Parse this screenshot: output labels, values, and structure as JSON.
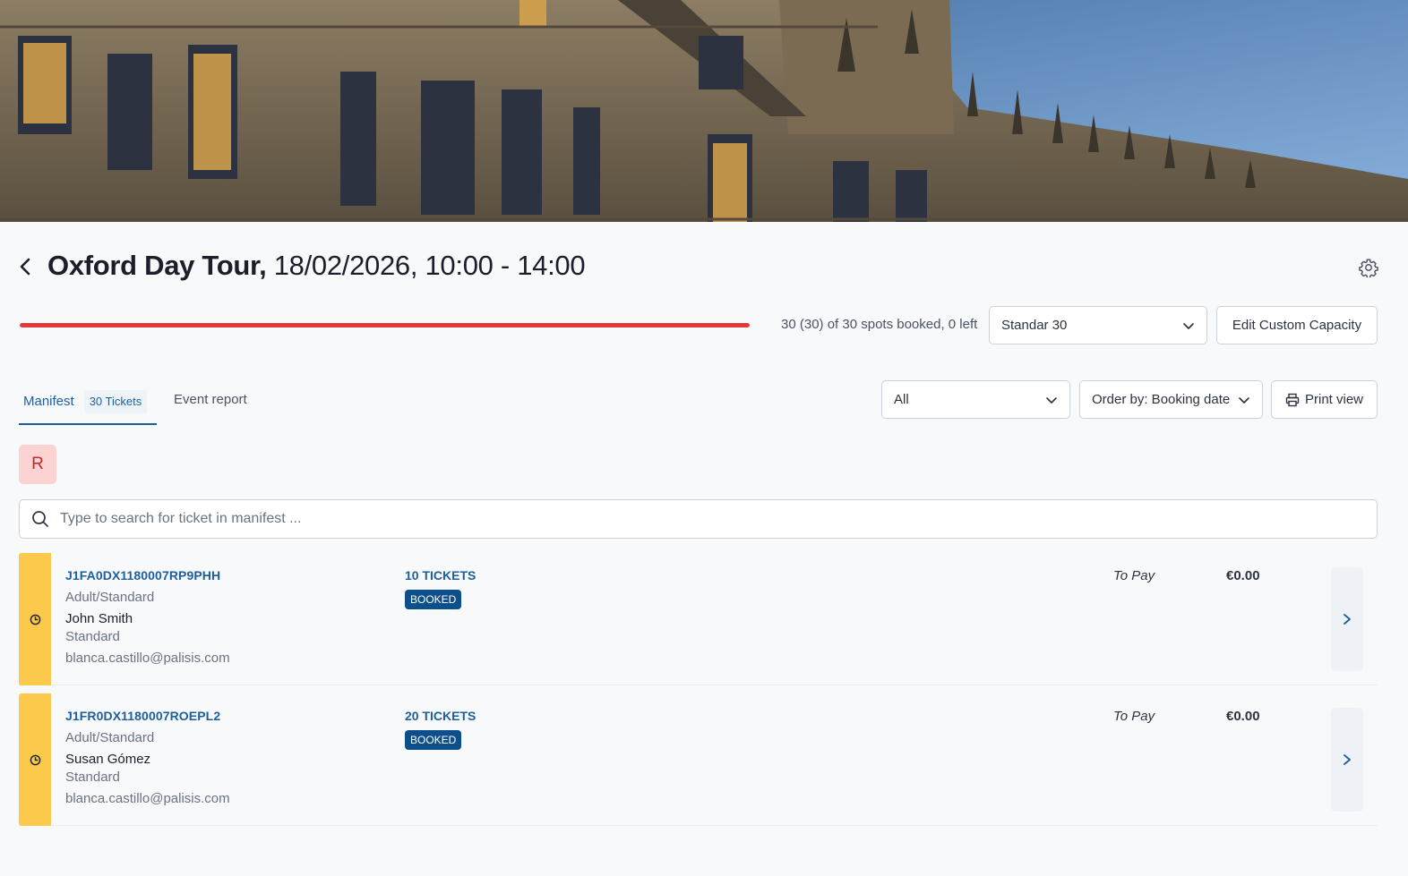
{
  "event": {
    "name": "Oxford Day Tour,",
    "datetime": "18/02/2026, 10:00 - 14:00"
  },
  "capacity": {
    "summary": "30 (30) of 30 spots booked, 0 left",
    "booked_fraction": 1.0,
    "bar_color": "#e53935",
    "plan_selected": "Standar 30",
    "edit_label": "Edit Custom Capacity"
  },
  "tabs": {
    "manifest_label": "Manifest",
    "manifest_count": "30 Tickets",
    "report_label": "Event report"
  },
  "filters": {
    "status_selected": "All",
    "order_selected": "Order by: Booking date",
    "print_label": "Print view"
  },
  "chip": {
    "label": "R"
  },
  "search": {
    "placeholder": "Type to search for ticket in manifest ..."
  },
  "bookings": [
    {
      "code": "J1FA0DX1180007RP9PHH",
      "ticket_type": "Adult/Standard",
      "customer": "John Smith",
      "rate": "Standard",
      "email": "blanca.castillo@palisis.com",
      "tickets": "10 TICKETS",
      "status": "BOOKED",
      "pay_label": "To Pay",
      "amount": "€0.00"
    },
    {
      "code": "J1FR0DX1180007ROEPL2",
      "ticket_type": "Adult/Standard",
      "customer": "Susan Gómez",
      "rate": "Standard",
      "email": "blanca.castillo@palisis.com",
      "tickets": "20 TICKETS",
      "status": "BOOKED",
      "pay_label": "To Pay",
      "amount": "€0.00"
    }
  ],
  "colors": {
    "accent": "#1d5f9c",
    "status_badge": "#0d4f8b",
    "pending_stripe": "#fbc94c",
    "chip_bg": "#fcd3d3"
  },
  "icons": {
    "back": "chevron-left-icon",
    "settings": "gear-icon",
    "dropdown": "chevron-down-icon",
    "print": "printer-icon",
    "search": "search-icon",
    "pending": "clock-icon",
    "open": "chevron-right-icon"
  }
}
